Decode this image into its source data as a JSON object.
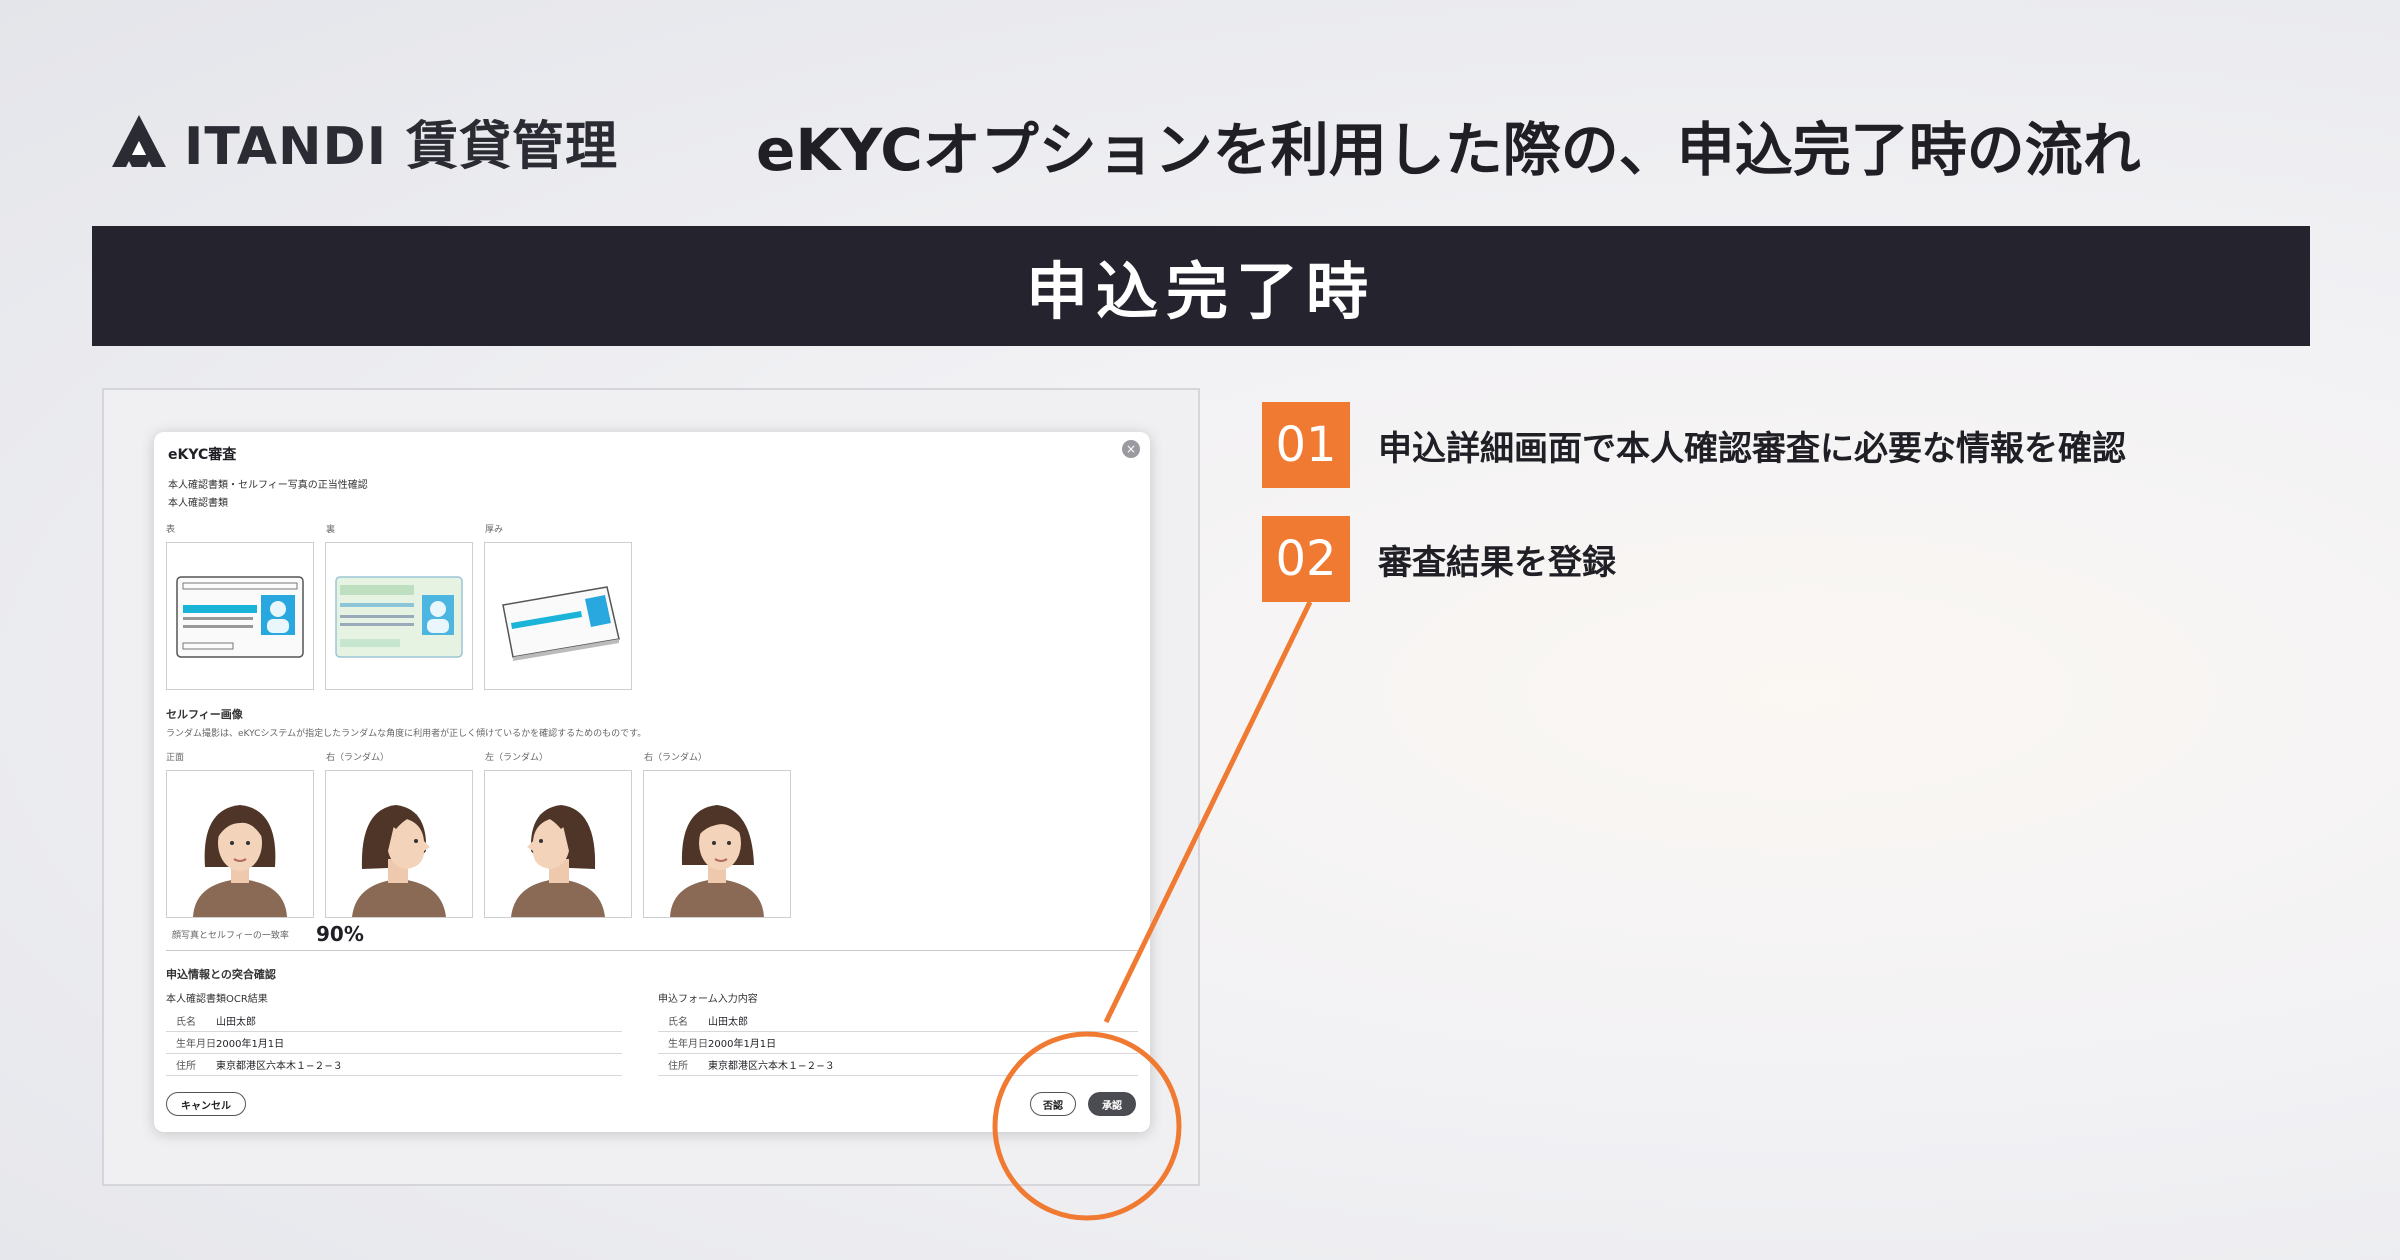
{
  "header": {
    "logo_text": "ITANDI 賃貸管理",
    "title": "eKYCオプションを利用した際の、申込完了時の流れ",
    "banner": "申込完了時"
  },
  "modal": {
    "title": "eKYC審査",
    "section1_title": "本人確認書類・セルフィー写真の正当性確認",
    "doc_label": "本人確認書類",
    "doc_cards": [
      "表",
      "裏",
      "厚み"
    ],
    "selfie_title": "セルフィー画像",
    "selfie_desc": "ランダム撮影は、eKYCシステムが指定したランダムな角度に利用者が正しく傾けているかを確認するためのものです。",
    "selfie_cards": [
      "正面",
      "右（ランダム）",
      "左（ランダム）",
      "右（ランダム）"
    ],
    "match_label": "顔写真とセルフィーの一致率",
    "match_value": "90%",
    "section2_title": "申込情報との突合確認",
    "ocr_title": "本人確認書類OCR結果",
    "form_title": "申込フォーム入力内容",
    "ocr_rows": [
      {
        "label": "氏名",
        "value": "山田太郎"
      },
      {
        "label": "生年月日",
        "value": "2000年1月1日"
      },
      {
        "label": "住所",
        "value": "東京都港区六本木１−２−３"
      }
    ],
    "form_rows": [
      {
        "label": "氏名",
        "value": "山田太郎"
      },
      {
        "label": "生年月日",
        "value": "2000年1月1日"
      },
      {
        "label": "住所",
        "value": "東京都港区六本木１−２−３"
      }
    ],
    "cancel_label": "キャンセル",
    "reject_label": "否認",
    "approve_label": "承認",
    "close_glyph": "×"
  },
  "steps": [
    {
      "number": "01",
      "text": "申込詳細画面で本人確認審査に必要な情報を確認"
    },
    {
      "number": "02",
      "text": "審査結果を登録"
    }
  ],
  "colors": {
    "accent": "#f07a31",
    "banner_bg": "#25242e",
    "button_dark": "#4b4b52"
  }
}
